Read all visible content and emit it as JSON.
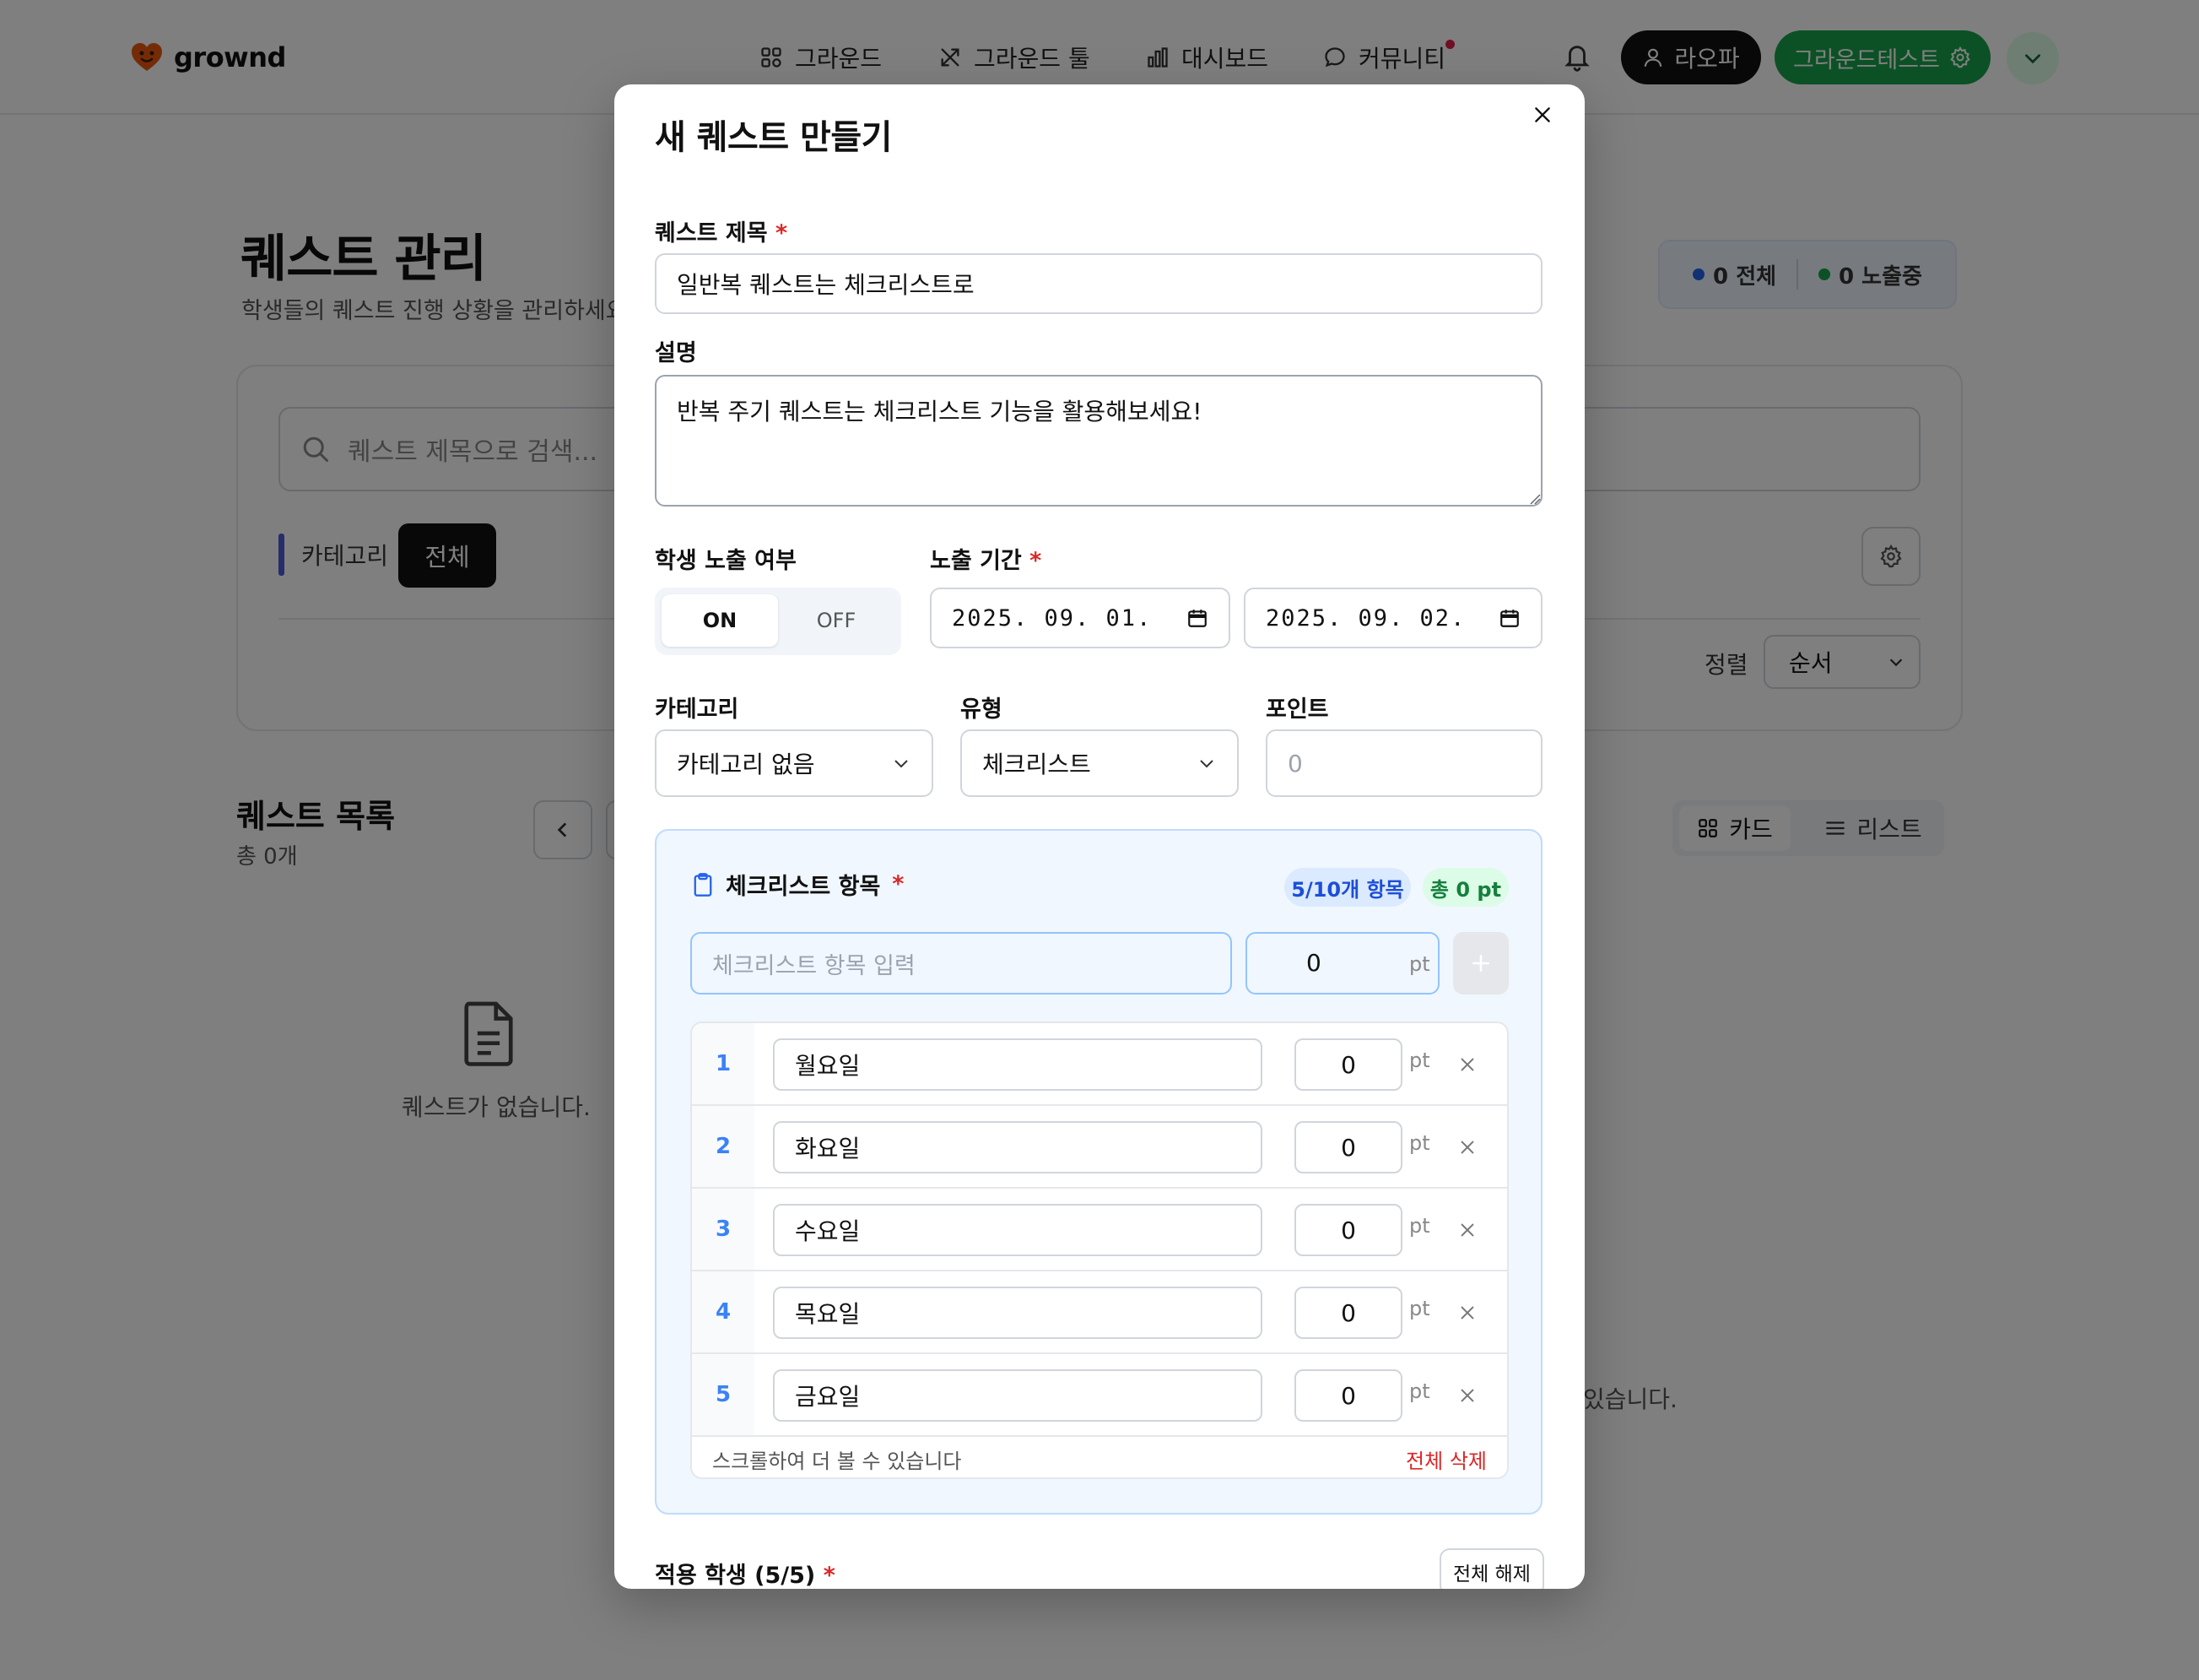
{
  "nav": {
    "logo": "grownd",
    "items": [
      {
        "label": "그라운드",
        "icon": "grid-icon"
      },
      {
        "label": "그라운드 툴",
        "icon": "tools-icon"
      },
      {
        "label": "대시보드",
        "icon": "bar-chart-icon"
      },
      {
        "label": "커뮤니티",
        "icon": "chat-icon",
        "badge": true
      }
    ],
    "user_label": "라오파",
    "class_label": "그라운드테스트"
  },
  "page": {
    "title": "퀘스트 관리",
    "subtitle": "학생들의 퀘스트 진행 상황을 관리하세요",
    "stats": {
      "total": "0 전체",
      "visible": "0 노출중",
      "total_color": "#2563eb",
      "visible_color": "#16a34a"
    },
    "search_placeholder": "퀘스트 제목으로 검색...",
    "category_label": "카테고리",
    "category_all": "전체",
    "sort_label": "정렬",
    "sort_value": "순서",
    "list_title": "퀘스트 목록",
    "list_count": "총 0개",
    "view_card": "카드",
    "view_list": "리스트",
    "empty_text": "퀘스트가 없습니다.",
    "empty_text_partial": "있습니다."
  },
  "modal": {
    "title": "새 퀘스트 만들기",
    "title_label": "퀘스트 제목",
    "title_value": "일반복 퀘스트는 체크리스트로",
    "desc_label": "설명",
    "desc_value": "반복 주기 퀘스트는 체크리스트 기능을 활용해보세요!",
    "expose_label": "학생 노출 여부",
    "on": "ON",
    "off": "OFF",
    "period_label": "노출 기간",
    "date_start": "2025. 09. 01.",
    "date_end": "2025. 09. 02.",
    "category_label": "카테고리",
    "category_value": "카테고리 없음",
    "type_label": "유형",
    "type_value": "체크리스트",
    "point_label": "포인트",
    "point_placeholder": "0",
    "required_mark": "*",
    "checklist": {
      "title": "체크리스트 항목",
      "count_badge": "5/10개 항목",
      "total_badge": "총 0 pt",
      "input_placeholder": "체크리스트 항목 입력",
      "input_pt": "0",
      "pt_unit": "pt",
      "items": [
        {
          "num": "1",
          "name": "월요일",
          "pt": "0"
        },
        {
          "num": "2",
          "name": "화요일",
          "pt": "0"
        },
        {
          "num": "3",
          "name": "수요일",
          "pt": "0"
        },
        {
          "num": "4",
          "name": "목요일",
          "pt": "0"
        },
        {
          "num": "5",
          "name": "금요일",
          "pt": "0"
        }
      ],
      "scroll_hint": "스크롤하여 더 볼 수 있습니다",
      "clear_all": "전체 삭제"
    },
    "students_label": "적용 학생 (5/5)",
    "deselect_all": "전체 해제"
  }
}
